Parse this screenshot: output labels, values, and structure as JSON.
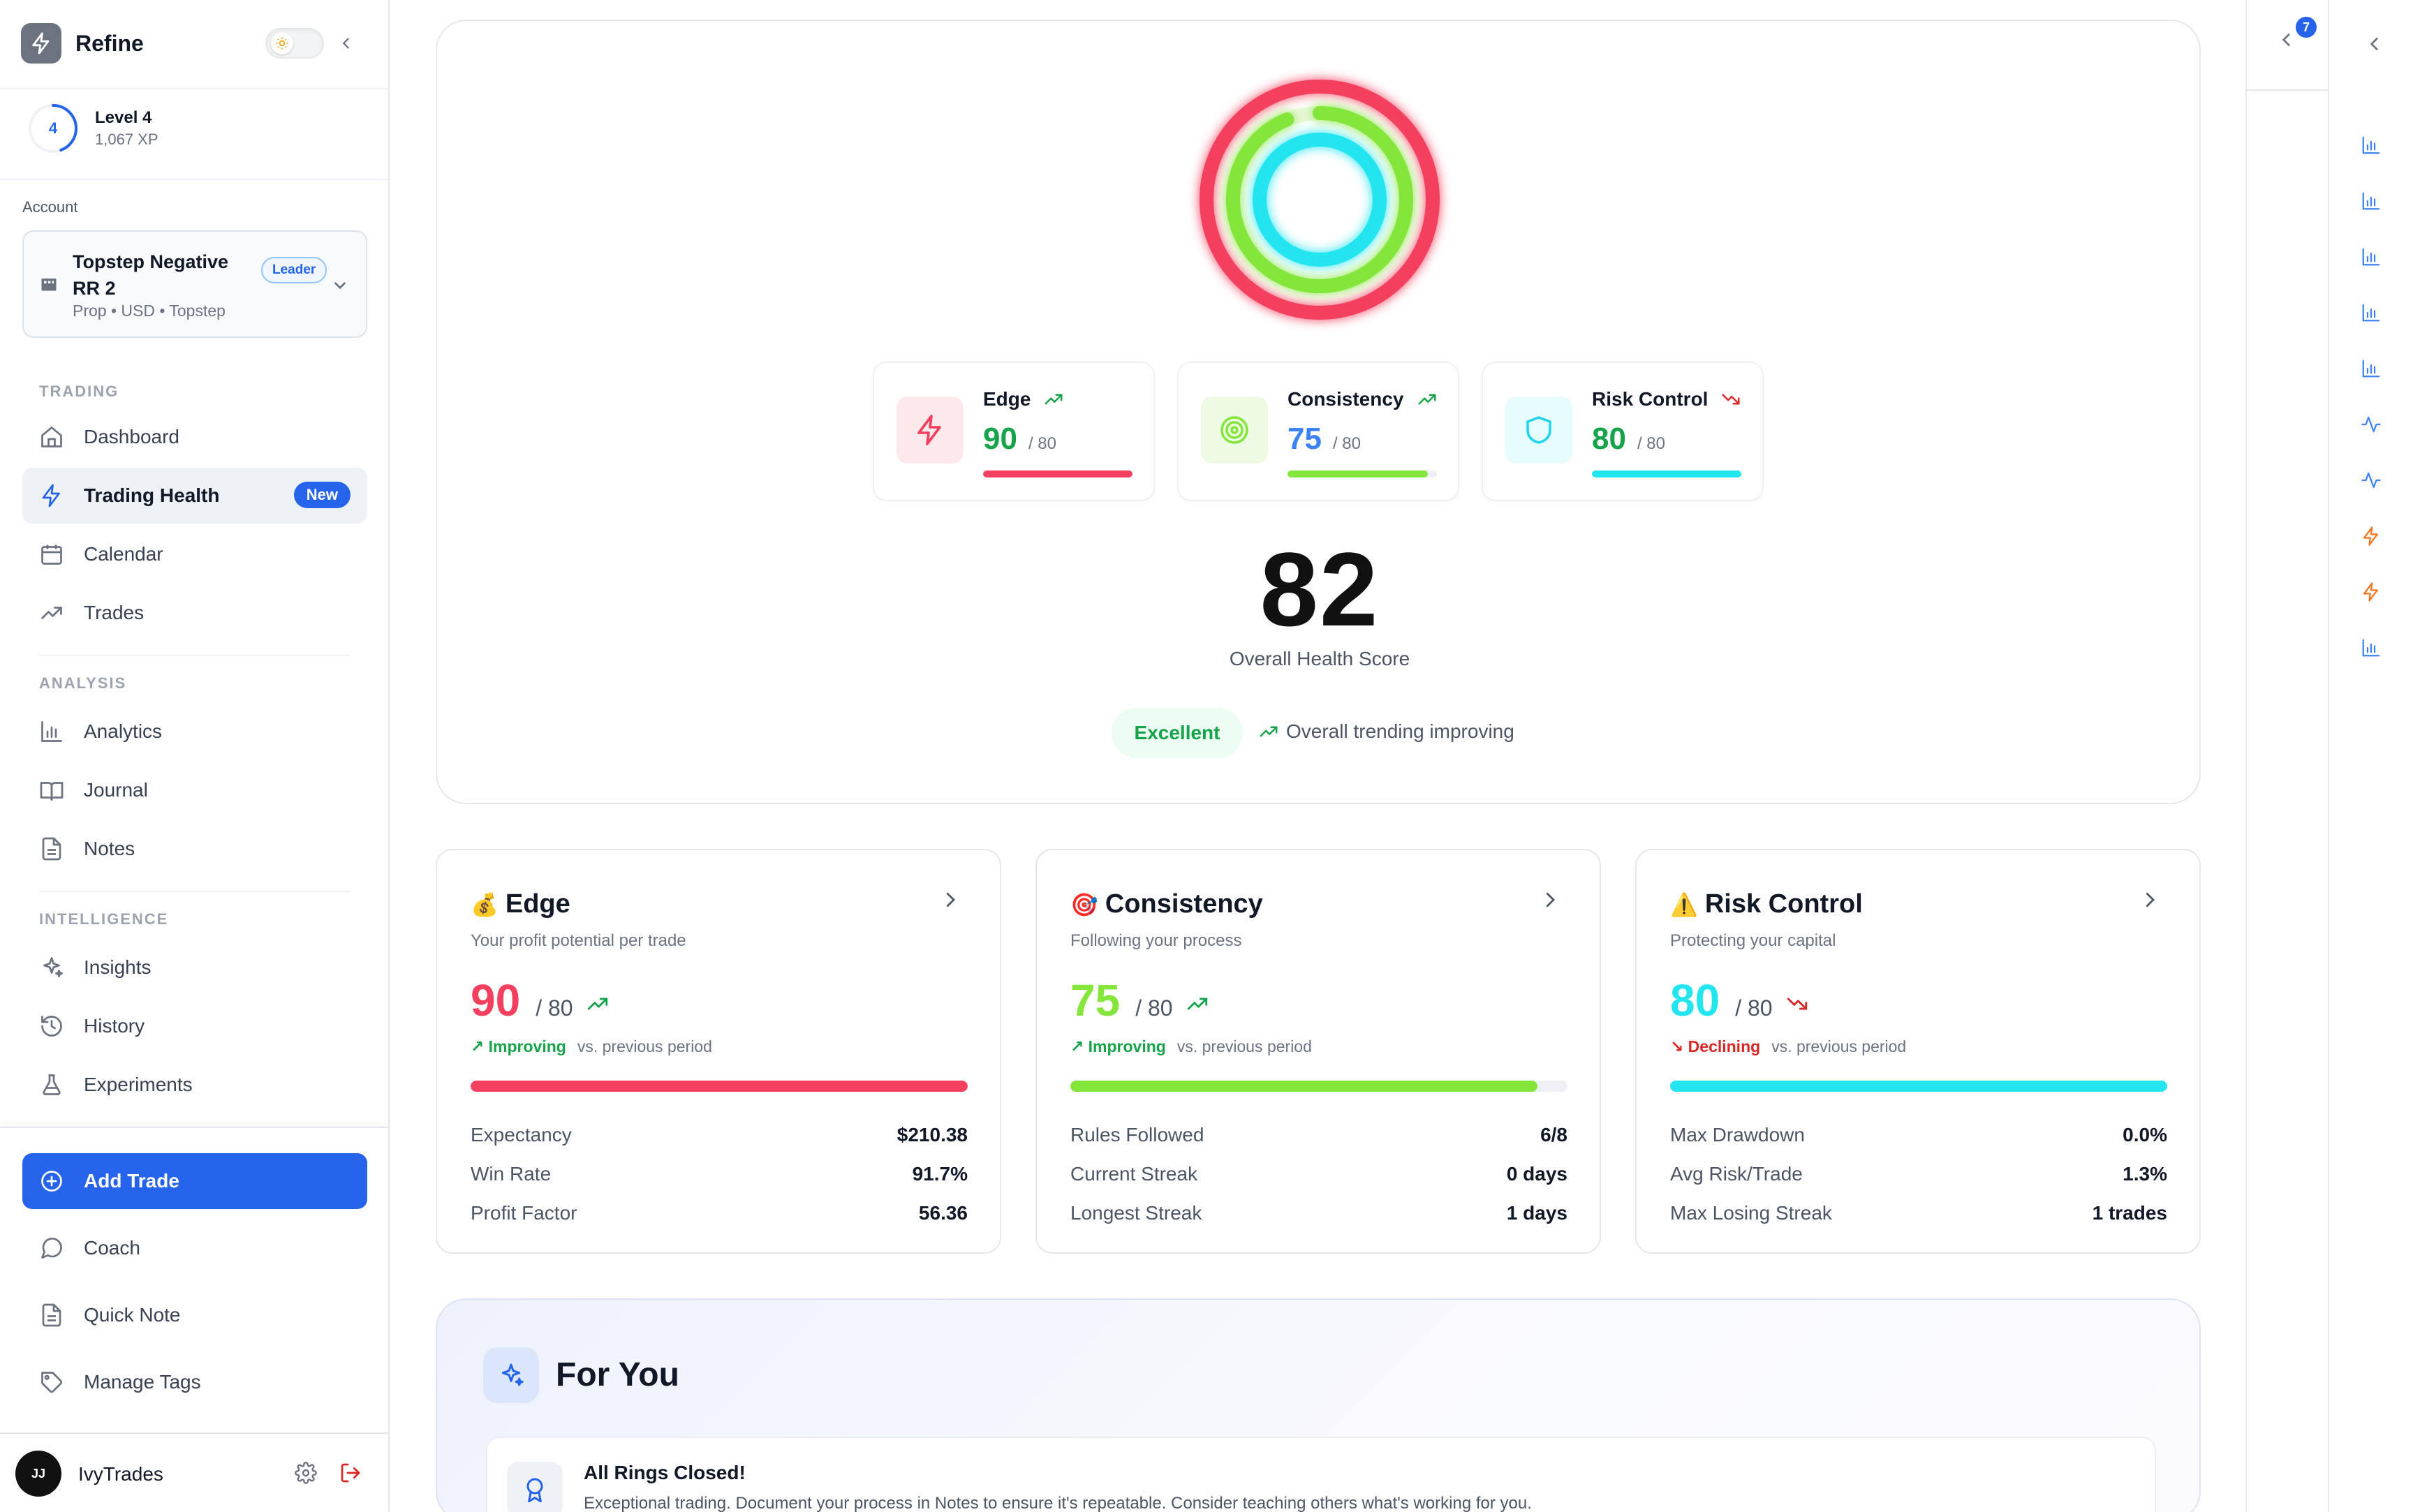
{
  "brand": {
    "name": "Refine"
  },
  "level": {
    "number": "4",
    "title": "Level 4",
    "xp": "1,067 XP"
  },
  "account": {
    "caption": "Account",
    "name": "Topstep Negative RR 2",
    "meta": "Prop • USD • Topstep",
    "badge": "Leader"
  },
  "nav": {
    "groups": [
      {
        "label": "TRADING"
      },
      {
        "label": "ANALYSIS"
      },
      {
        "label": "INTELLIGENCE"
      }
    ],
    "items": [
      {
        "label": "Dashboard"
      },
      {
        "label": "Trading Health",
        "badge": "New"
      },
      {
        "label": "Calendar"
      },
      {
        "label": "Trades"
      },
      {
        "label": "Analytics"
      },
      {
        "label": "Journal"
      },
      {
        "label": "Notes"
      },
      {
        "label": "Insights"
      },
      {
        "label": "History"
      },
      {
        "label": "Experiments"
      }
    ],
    "bottom": [
      {
        "label": "Add Trade"
      },
      {
        "label": "Coach"
      },
      {
        "label": "Quick Note"
      },
      {
        "label": "Manage Tags"
      }
    ]
  },
  "user": {
    "avatar": "JJ",
    "name": "IvyTrades"
  },
  "colors": {
    "edge": "#f43f5e",
    "consistency": "#84e63a",
    "risk": "#22e5f0",
    "accent": "#2563eb",
    "good": "#16a34a",
    "bad": "#dc2626"
  },
  "summary": {
    "metrics": [
      {
        "name": "Edge",
        "value": "90",
        "max": "/ 80",
        "trend": "up",
        "fill": 1.0,
        "icon": "zap-icon"
      },
      {
        "name": "Consistency",
        "value": "75",
        "max": "/ 80",
        "trend": "up",
        "fill": 0.94,
        "icon": "target-icon"
      },
      {
        "name": "Risk Control",
        "value": "80",
        "max": "/ 80",
        "trend": "down",
        "fill": 1.0,
        "icon": "shield-icon"
      }
    ],
    "overall_score": "82",
    "overall_label": "Overall Health Score",
    "status": "Excellent",
    "trend_text": "Overall trending improving"
  },
  "cards": [
    {
      "emoji": "💰",
      "title": "Edge",
      "subtitle": "Your profit potential per trade",
      "value": "90",
      "max": "/ 80",
      "trend_label": "↗ Improving",
      "period": "vs. previous period",
      "trend": "up",
      "fill": 1.0,
      "stats": [
        {
          "label": "Expectancy",
          "value": "$210.38"
        },
        {
          "label": "Win Rate",
          "value": "91.7%"
        },
        {
          "label": "Profit Factor",
          "value": "56.36"
        }
      ]
    },
    {
      "emoji": "🎯",
      "title": "Consistency",
      "subtitle": "Following your process",
      "value": "75",
      "max": "/ 80",
      "trend_label": "↗ Improving",
      "period": "vs. previous period",
      "trend": "up",
      "fill": 0.94,
      "stats": [
        {
          "label": "Rules Followed",
          "value": "6/8"
        },
        {
          "label": "Current Streak",
          "value": "0 days"
        },
        {
          "label": "Longest Streak",
          "value": "1 days"
        }
      ]
    },
    {
      "emoji": "⚠️",
      "title": "Risk Control",
      "subtitle": "Protecting your capital",
      "value": "80",
      "max": "/ 80",
      "trend_label": "↘ Declining",
      "period": "vs. previous period",
      "trend": "down",
      "fill": 1.0,
      "stats": [
        {
          "label": "Max Drawdown",
          "value": "0.0%"
        },
        {
          "label": "Avg Risk/Trade",
          "value": "1.3%"
        },
        {
          "label": "Max Losing Streak",
          "value": "1 trades"
        }
      ]
    }
  ],
  "for_you": {
    "title": "For You",
    "item_title": "All Rings Closed!",
    "item_text": "Exceptional trading. Document your process in Notes to ensure it's repeatable. Consider teaching others what's working for you."
  },
  "rail": {
    "badge": "7",
    "icons": [
      "bar-chart-icon",
      "bar-chart-icon",
      "bar-chart-icon",
      "bar-chart-icon",
      "bar-chart-icon",
      "activity-icon",
      "activity-icon",
      "zap-icon",
      "zap-icon",
      "bar-chart-icon"
    ]
  }
}
